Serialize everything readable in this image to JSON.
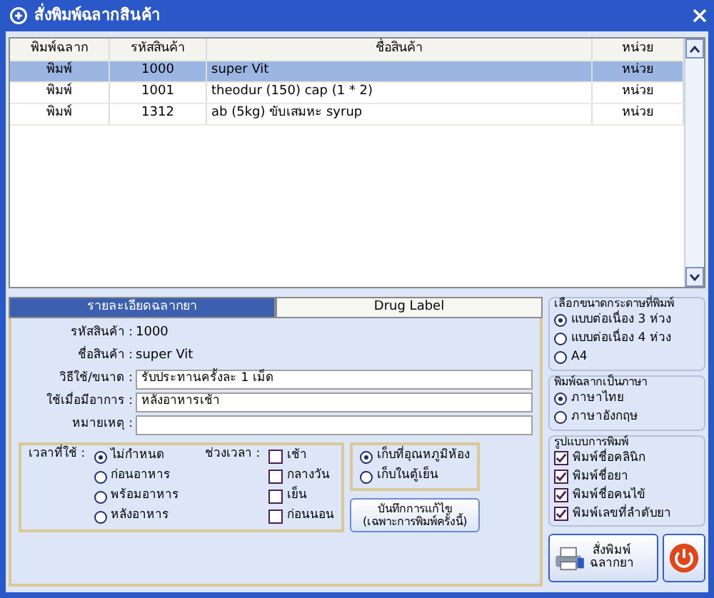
{
  "window": {
    "title": "สั่งพิมพ์ฉลากสินค้า"
  },
  "table": {
    "columns": [
      "พิมพ์ฉลาก",
      "รหัสสินค้า",
      "ชื่อสินค้า",
      "หน่วย"
    ],
    "rows": [
      {
        "cells": [
          "พิมพ์",
          "1000",
          "super Vit",
          "หน่วย"
        ],
        "selected": true
      },
      {
        "cells": [
          "พิมพ์",
          "1001",
          "theodur (150) cap (1 * 2)",
          "หน่วย"
        ],
        "selected": false
      },
      {
        "cells": [
          "พิมพ์",
          "1312",
          "ab (5kg) ขับเสมหะ syrup",
          "หน่วย"
        ],
        "selected": false
      }
    ]
  },
  "tabs": [
    {
      "label": "รายละเอียดฉลากยา",
      "selected": true
    },
    {
      "label": "Drug Label",
      "selected": false
    }
  ],
  "details": [
    {
      "label": "รหัสสินค้า :",
      "value": "1000",
      "kind": "text"
    },
    {
      "label": "ชื่อสินค้า :",
      "value": "super Vit",
      "kind": "text"
    },
    {
      "label": "วิธีใช้/ขนาด :",
      "value": "รับประทานครั้งละ 1 เม็ด",
      "kind": "input"
    },
    {
      "label": "ใช้เมื่อมีอาการ :",
      "value": "หลังอาหารเช้า",
      "kind": "input"
    },
    {
      "label": "หมายเหตุ :",
      "kind": "input"
    }
  ],
  "time_of_use": {
    "label": "เวลาที่ใช้ :",
    "options": [
      {
        "label": "ไม่กำหนด",
        "selected": true
      },
      {
        "label": "ก่อนอาหาร",
        "selected": false
      },
      {
        "label": "พร้อมอาหาร",
        "selected": false
      },
      {
        "label": "หลังอาหาร",
        "selected": false
      }
    ]
  },
  "period": {
    "label": "ช่วงเวลา :",
    "options": [
      {
        "label": "เช้า",
        "checked": false
      },
      {
        "label": "กลางวัน",
        "checked": false
      },
      {
        "label": "เย็น",
        "checked": false
      },
      {
        "label": "ก่อนนอน",
        "checked": false
      }
    ]
  },
  "storage": [
    {
      "label": "เก็บที่อุณหภูมิห้อง",
      "selected": true
    },
    {
      "label": "เก็บในตู้เย็น",
      "selected": false
    }
  ],
  "save_button": [
    "บันทึกการแก้ไข",
    "(เฉพาะการพิมพ์ครั้งนี้)"
  ],
  "paper_size": {
    "title": "เลือกขนาดกระดาษที่พิมพ์",
    "options": [
      {
        "label": "แบบต่อเนื่อง 3 ห่วง",
        "selected": true
      },
      {
        "label": "แบบต่อเนื่อง 4 ห่วง",
        "selected": false
      },
      {
        "label": "A4",
        "selected": false
      }
    ]
  },
  "language": {
    "title": "พิมพ์ฉลากเป็นภาษา",
    "options": [
      {
        "label": "ภาษาไทย",
        "selected": true
      },
      {
        "label": "ภาษาอังกฤษ",
        "selected": false
      }
    ]
  },
  "print_format": {
    "title": "รูปแบบการพิมพ์",
    "options": [
      {
        "label": "พิมพ์ชื่อคลินิก",
        "checked": true
      },
      {
        "label": "พิมพ์ชื่อยา",
        "checked": true
      },
      {
        "label": "พิมพ์ชื่อคนไข้",
        "checked": true
      },
      {
        "label": "พิมพ์เลขที่ลำดับยา",
        "checked": true
      }
    ]
  },
  "print_button": [
    "สั่งพิมพ์",
    "ฉลากยา"
  ]
}
